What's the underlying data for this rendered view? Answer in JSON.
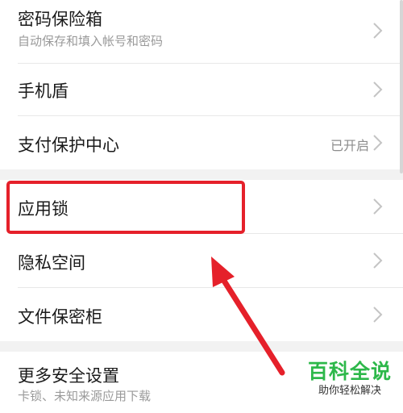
{
  "settings": {
    "items": [
      {
        "title": "密码保险箱",
        "subtitle": "自动保存和填入帐号和密码"
      },
      {
        "title": "手机盾"
      },
      {
        "title": "支付保护中心",
        "value": "已开启"
      },
      {
        "title": "应用锁"
      },
      {
        "title": "隐私空间"
      },
      {
        "title": "文件保密柜"
      },
      {
        "title": "更多安全设置",
        "subtitle": "卡锁、未知来源应用下载"
      }
    ]
  },
  "annotation": {
    "highlight_color": "#e5202a",
    "highlighted_item": "应用锁"
  },
  "watermark": {
    "main": "百科全说",
    "sub": "助你轻松解决",
    "color": "#2db84a"
  },
  "colors": {
    "background": "#ffffff",
    "section_gap": "#f2f2f2",
    "divider": "#e8e8e8",
    "title_text": "#1a1a1a",
    "secondary_text": "#9a9a9a",
    "chevron": "#c4c4c4"
  }
}
